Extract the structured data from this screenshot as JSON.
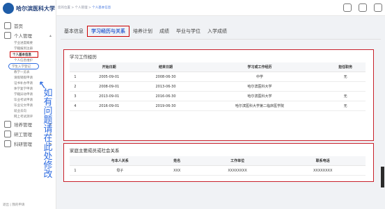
{
  "app": {
    "logo_text": "哈尔滨医科大学"
  },
  "breadcrumb": {
    "part1": "您的位置 > 个人管理 >",
    "part2": "个人基本信息"
  },
  "sidebar": {
    "home": "首页",
    "personal": "个人管理",
    "sub": [
      "学业进度概要",
      "学籍报到注册",
      "个人基本信息",
      "个人信息维护",
      "学生入学登记",
      "教学一览表",
      "请假销假申请",
      "证书补办申请",
      "休学复学申请",
      "学籍异动申请",
      "毕业考试申请",
      "毕业论文申请",
      "就业去向",
      "网上考试测评"
    ],
    "training": "培养管理",
    "research_mgmt": "研工管理",
    "research": "科研管理",
    "bottom": "退出  |  我的申请"
  },
  "tabs": [
    {
      "label": "基本信息"
    },
    {
      "label": "学习经历与关系"
    },
    {
      "label": "培养计划"
    },
    {
      "label": "成绩"
    },
    {
      "label": "毕业与学位"
    },
    {
      "label": "入学成绩"
    }
  ],
  "panel1": {
    "title": "学习工作经历",
    "headers": [
      "开始日期",
      "结束日期",
      "学习或工作经历",
      "担任职务"
    ],
    "rows": [
      {
        "n": "1",
        "start": "2005-09-01",
        "end": "2008-06-30",
        "org": "中学",
        "role": "无"
      },
      {
        "n": "2",
        "start": "2008-09-01",
        "end": "2013-06-30",
        "org": "哈尔滨医科大学",
        "role": ""
      },
      {
        "n": "3",
        "start": "2013-09-01",
        "end": "2016-06-30",
        "org": "哈尔滨医科大学",
        "role": "无"
      },
      {
        "n": "4",
        "start": "2016-09-01",
        "end": "2019-06-30",
        "org": "哈尔滨医科大学第二临床医学院",
        "role": "无"
      }
    ]
  },
  "panel2": {
    "title": "家庭主要成员或社会关系",
    "headers": [
      "与本人关系",
      "姓名",
      "工作单位",
      "联系电话"
    ],
    "rows": [
      {
        "n": "1",
        "rel": "母子",
        "name": "XXX",
        "unit": "XXXXXXXX",
        "phone": "XXXXXXXX"
      }
    ]
  },
  "annotation": "如有问题请在此处修改"
}
